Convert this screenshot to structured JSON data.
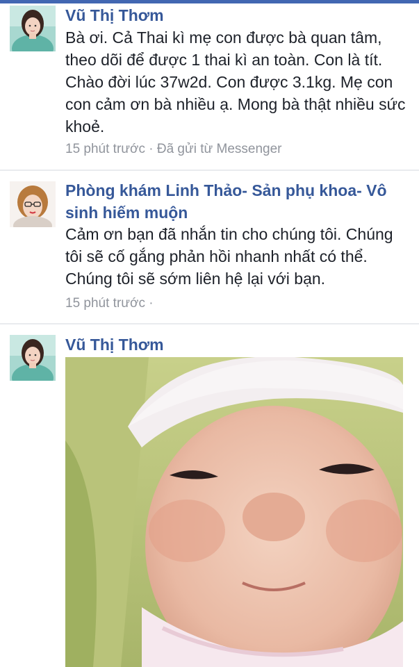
{
  "messages": [
    {
      "sender": "Vũ Thị Thơm",
      "text": "Bà ơi. Cả Thai kì mẹ con được bà quan tâm, theo dõi để được 1 thai kì an toàn. Con là tít. Chào đời lúc 37w2d. Con được 3.1kg. Mẹ con con cảm ơn bà nhiều ạ. Mong bà thật nhiều sức khoẻ.",
      "time": "15 phút trước",
      "separator": " · ",
      "source": "Đã gửi từ Messenger"
    },
    {
      "sender": "Phòng khám Linh Thảo- Sản phụ khoa- Vô sinh hiếm muộn",
      "text": "Cảm ơn bạn đã nhắn tin cho chúng tôi. Chúng tôi sẽ cố gắng phản hồi nhanh nhất có thể. Chúng tôi sẽ sớm liên hệ lại với bạn.",
      "time": "15 phút trước",
      "separator": " ·"
    },
    {
      "sender": "Vũ Thị Thơm",
      "attachment": "photo-of-newborn-baby"
    }
  ],
  "colors": {
    "name": "#365899",
    "text": "#1d2129",
    "meta": "#90949c",
    "divider": "#e9ebee",
    "topbar": "#4267b2"
  }
}
